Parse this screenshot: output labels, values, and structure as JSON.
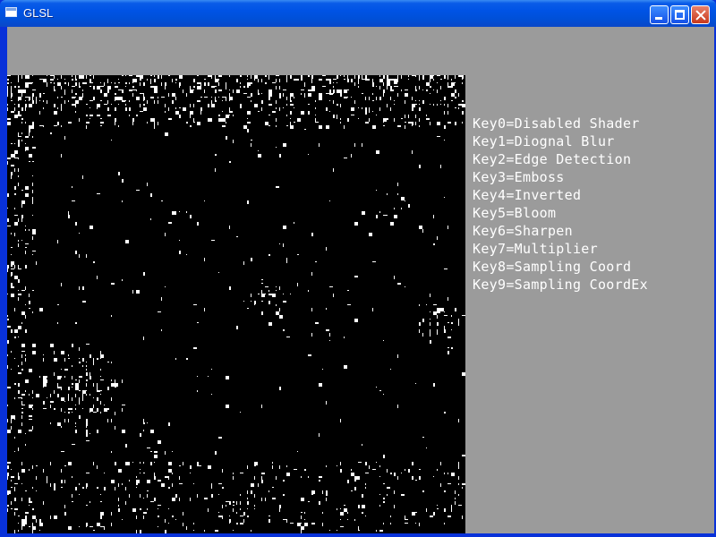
{
  "window": {
    "title": "GLSL",
    "icon": "application-window-icon",
    "buttons": [
      "minimize",
      "maximize",
      "close"
    ],
    "colors": {
      "client_background": "#9b9b9b",
      "viewport_background": "#000000",
      "legend_text": "#ffffff",
      "titlebar": "#0053e5"
    }
  },
  "legend": {
    "items": [
      "Key0=Disabled Shader",
      "Key1=Diognal Blur",
      "Key2=Edge Detection",
      "Key3=Emboss",
      "Key4=Inverted",
      "Key5=Bloom",
      "Key6=Sharpen",
      "Key7=Multiplier",
      "Key8=Sampling Coord",
      "Key9=Sampling CoordEx"
    ]
  }
}
